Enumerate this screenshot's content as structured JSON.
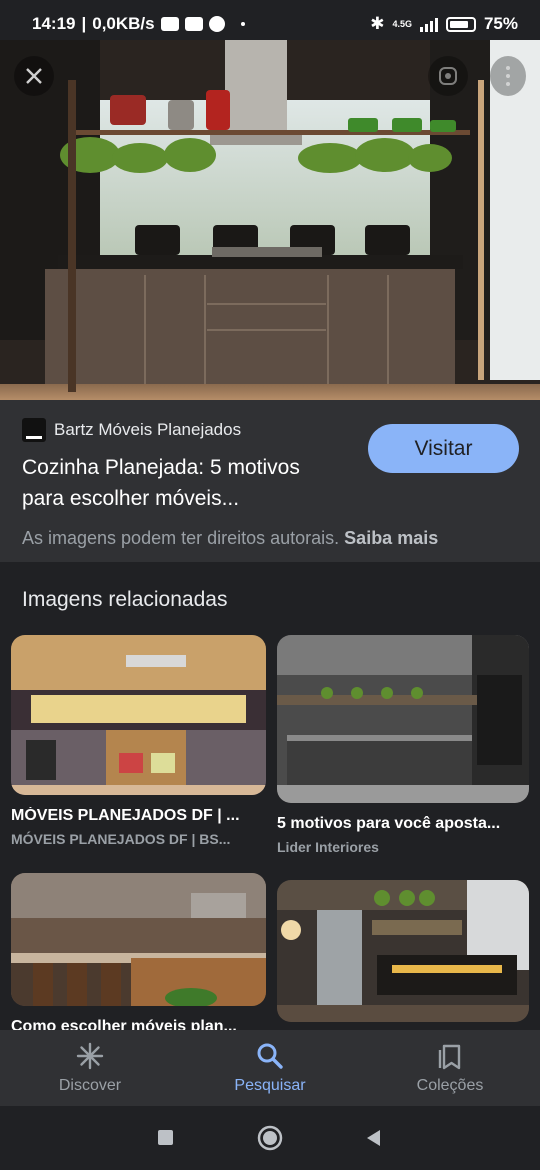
{
  "status_bar": {
    "time": "14:19",
    "net_speed": "0,0KB/s",
    "network_type": "4.5G",
    "battery": "75",
    "battery_unit": "%"
  },
  "hero": {
    "close_icon": "close-icon",
    "lens_icon": "lens-icon",
    "menu_icon": "more-vert-icon"
  },
  "result": {
    "source": "Bartz Móveis Planejados",
    "title_line1": "Cozinha Planejada: 5 motivos",
    "title_line2": "para escolher móveis...",
    "visit_label": "Visitar",
    "copyright_text": "As imagens podem ter direitos autorais.",
    "learn_more": "Saiba mais"
  },
  "related": {
    "heading": "Imagens relacionadas",
    "items": [
      {
        "caption": "MÓVEIS PLANEJADOS DF | ...",
        "source": "MÓVEIS PLANEJADOS DF | BS..."
      },
      {
        "caption": "5 motivos para você aposta...",
        "source": "Lider Interiores"
      },
      {
        "caption": "Como escolher móveis plan...",
        "source": ""
      },
      {
        "caption": "",
        "source": ""
      }
    ]
  },
  "bottom_nav": {
    "items": [
      {
        "label": "Discover",
        "icon": "asterisk-icon"
      },
      {
        "label": "Pesquisar",
        "icon": "search-icon"
      },
      {
        "label": "Coleções",
        "icon": "collections-icon"
      }
    ],
    "active": "Pesquisar"
  },
  "colors": {
    "accent": "#8ab4f8",
    "background": "#202124",
    "panel": "#303134"
  }
}
